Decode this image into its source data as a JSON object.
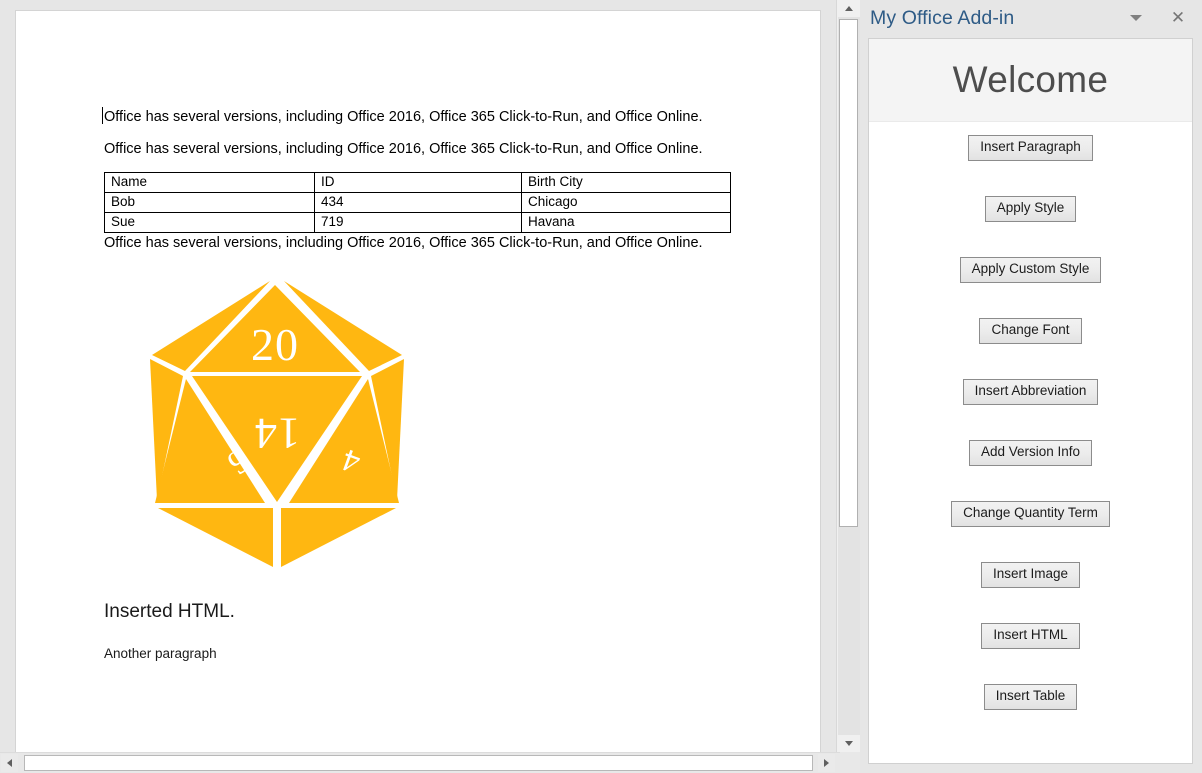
{
  "document": {
    "paragraph_1": "Office has several versions, including Office 2016, Office 365 Click-to-Run, and Office Online.",
    "paragraph_2": "Office has several versions, including Office 2016, Office 365 Click-to-Run, and Office Online.",
    "paragraph_3": "Office has several versions, including Office 2016, Office 365 Click-to-Run, and Office Online.",
    "table": {
      "headers": [
        "Name",
        "ID",
        "Birth City"
      ],
      "rows": [
        [
          "Bob",
          "434",
          "Chicago"
        ],
        [
          "Sue",
          "719",
          "Havana"
        ]
      ]
    },
    "image": {
      "name": "d20-die-image",
      "alt": "Twenty-sided die",
      "color": "#FFB711",
      "face_numbers": [
        "20",
        "14",
        "6",
        "4"
      ]
    },
    "inserted_heading": "Inserted HTML.",
    "inserted_paragraph": "Another paragraph"
  },
  "scrollbars": {
    "vertical": {
      "up_icon": "triangle-up-icon",
      "down_icon": "triangle-down-icon"
    },
    "horizontal": {
      "left_icon": "triangle-left-icon",
      "right_icon": "triangle-right-icon"
    }
  },
  "taskpane": {
    "title": "My Office Add-in",
    "title_color": "#2E5B86",
    "dropdown_icon": "chevron-down-icon",
    "close_icon": "close-icon",
    "close_glyph": "✕",
    "welcome": "Welcome",
    "buttons": [
      {
        "label": "Insert Paragraph",
        "name": "insert-paragraph-button"
      },
      {
        "label": "Apply Style",
        "name": "apply-style-button"
      },
      {
        "label": "Apply Custom Style",
        "name": "apply-custom-style-button"
      },
      {
        "label": "Change Font",
        "name": "change-font-button"
      },
      {
        "label": "Insert Abbreviation",
        "name": "insert-abbreviation-button"
      },
      {
        "label": "Add Version Info",
        "name": "add-version-info-button"
      },
      {
        "label": "Change Quantity Term",
        "name": "change-quantity-term-button"
      },
      {
        "label": "Insert Image",
        "name": "insert-image-button"
      },
      {
        "label": "Insert HTML",
        "name": "insert-html-button"
      },
      {
        "label": "Insert Table",
        "name": "insert-table-button"
      }
    ]
  }
}
